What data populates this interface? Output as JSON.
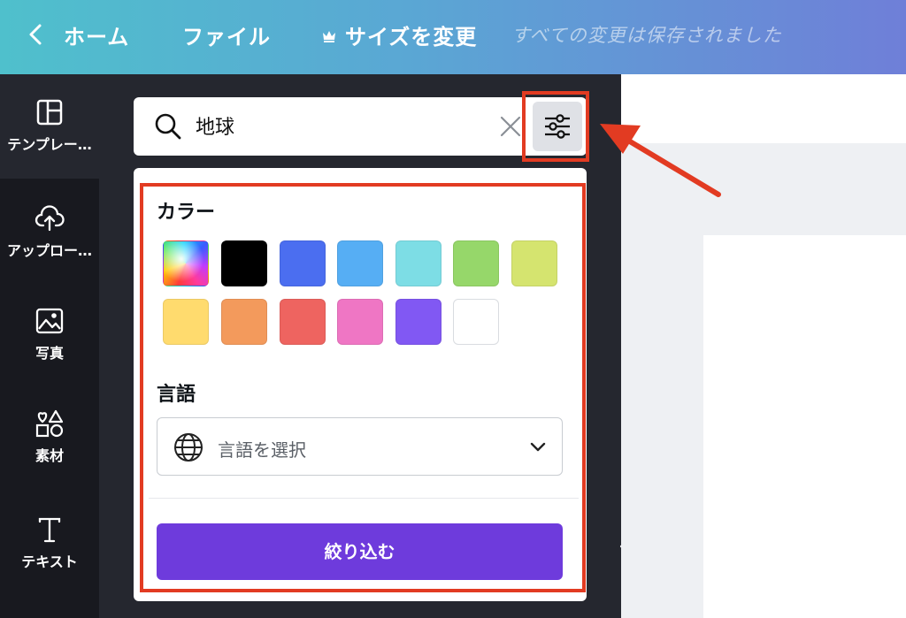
{
  "topbar": {
    "home_label": "ホーム",
    "file_label": "ファイル",
    "resize_label": "サイズを変更",
    "saved_status": "すべての変更は保存されました"
  },
  "sidebar": {
    "items": [
      {
        "label": "テンプレー…",
        "icon": "template-icon"
      },
      {
        "label": "アップロー…",
        "icon": "upload-cloud-icon"
      },
      {
        "label": "写真",
        "icon": "photo-icon"
      },
      {
        "label": "素材",
        "icon": "elements-icon"
      },
      {
        "label": "テキスト",
        "icon": "text-icon"
      }
    ]
  },
  "search": {
    "value": "地球",
    "placeholder": ""
  },
  "filter": {
    "color_title": "カラー",
    "colors": [
      "rainbow",
      "#000000",
      "#4b6ef0",
      "#56aef4",
      "#7ddde5",
      "#96d76a",
      "#d5e46f",
      "#ffdb6e",
      "#f39a5c",
      "#ee6460",
      "#ef76c4",
      "#8158f3",
      "#ffffff"
    ],
    "language_title": "言語",
    "language_placeholder": "言語を選択",
    "apply_label": "絞り込む"
  },
  "accent": {
    "highlight": "#e23b22",
    "button": "#6e3bdc"
  }
}
